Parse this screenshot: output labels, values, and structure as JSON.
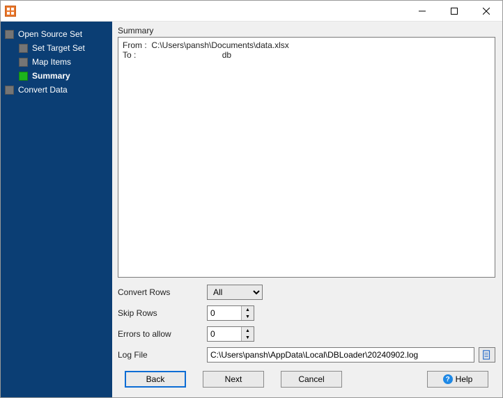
{
  "window": {
    "title": ""
  },
  "sidebar": {
    "items": [
      {
        "label": "Open Source Set",
        "current": false
      },
      {
        "label": "Set Target Set",
        "current": false
      },
      {
        "label": "Map Items",
        "current": false
      },
      {
        "label": "Summary",
        "current": true
      },
      {
        "label": "Convert Data",
        "current": false
      }
    ]
  },
  "main": {
    "section_title": "Summary",
    "summary_text": "From :  C:\\Users\\pansh\\Documents\\data.xlsx\nTo :                                     db",
    "rows": {
      "convert_rows": {
        "label": "Convert Rows",
        "value": "All"
      },
      "skip_rows": {
        "label": "Skip Rows",
        "value": "0"
      },
      "errors_allow": {
        "label": "Errors to allow",
        "value": "0"
      },
      "log_file": {
        "label": "Log File",
        "value": "C:\\Users\\pansh\\AppData\\Local\\DBLoader\\20240902.log"
      }
    }
  },
  "buttons": {
    "back": "Back",
    "next": "Next",
    "cancel": "Cancel",
    "help": "Help"
  }
}
